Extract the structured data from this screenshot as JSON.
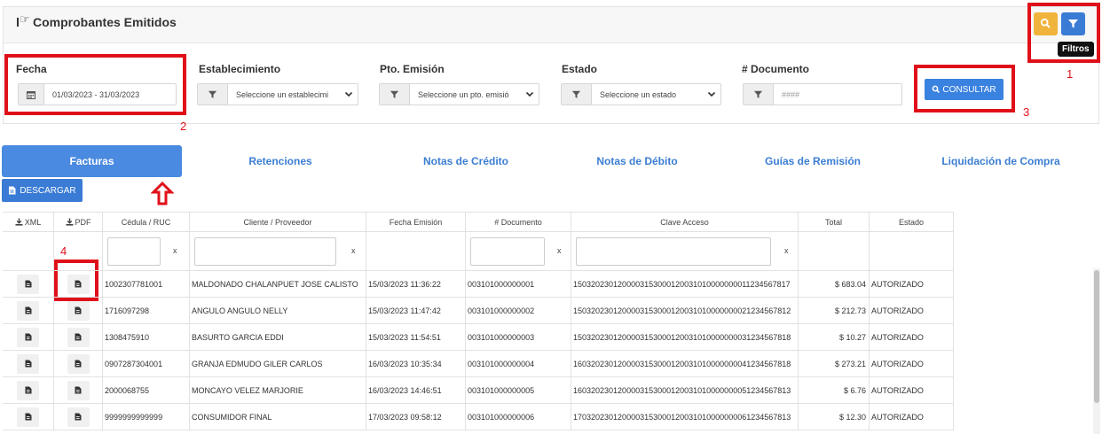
{
  "header": {
    "title": "Comprobantes Emitidos",
    "tooltip": "Filtros",
    "search_icon": "search-icon",
    "filter_icon": "filter-icon"
  },
  "filters": {
    "fecha_label": "Fecha",
    "fecha_value": "01/03/2023 - 31/03/2023",
    "establecimiento_label": "Establecimiento",
    "establecimiento_value": "Seleccione un establecimi",
    "pto_emision_label": "Pto. Emisión",
    "pto_emision_value": "Seleccione un pto. emisió",
    "estado_label": "Estado",
    "estado_value": "Seleccione un estado",
    "documento_label": "# Documento",
    "documento_placeholder": "####",
    "consultar_label": "CONSULTAR"
  },
  "annotations": [
    "1",
    "2",
    "3",
    "4"
  ],
  "tabs": [
    {
      "label": "Facturas",
      "active": true
    },
    {
      "label": "Retenciones"
    },
    {
      "label": "Notas de Crédito"
    },
    {
      "label": "Notas de Débito"
    },
    {
      "label": "Guías de Remisión"
    },
    {
      "label": "Liquidación de Compra"
    }
  ],
  "descargar_label": "DESCARGAR",
  "table": {
    "columns": [
      "XML",
      "PDF",
      "Cédula / RUC",
      "Cliente / Proveedor",
      "Fecha Emisión",
      "# Documento",
      "Clave Acceso",
      "Total",
      "Estado"
    ],
    "filter_clear": "x",
    "rows": [
      {
        "ruc": "1002307781001",
        "cliente": "MALDONADO CHALANPUET JOSE CALISTO",
        "fecha": "15/03/2023 11:36:22",
        "documento": "003101000000001",
        "clave": "1503202301200003153000120031010000000011234567817",
        "total": "$ 683.04",
        "estado": "AUTORIZADO"
      },
      {
        "ruc": "1716097298",
        "cliente": "ANGULO ANGULO NELLY",
        "fecha": "15/03/2023 11:47:42",
        "documento": "003101000000002",
        "clave": "1503202301200003153000120031010000000021234567812",
        "total": "$ 212.73",
        "estado": "AUTORIZADO"
      },
      {
        "ruc": "1308475910",
        "cliente": "BASURTO GARCIA EDDI",
        "fecha": "15/03/2023 11:54:51",
        "documento": "003101000000003",
        "clave": "1503202301200003153000120031010000000031234567818",
        "total": "$ 10.27",
        "estado": "AUTORIZADO"
      },
      {
        "ruc": "0907287304001",
        "cliente": "GRANJA EDMUDO GILER CARLOS",
        "fecha": "16/03/2023 10:35:34",
        "documento": "003101000000004",
        "clave": "1603202301200003153000120031010000000041234567818",
        "total": "$ 273.21",
        "estado": "AUTORIZADO"
      },
      {
        "ruc": "2000068755",
        "cliente": "MONCAYO VELEZ MARJORIE",
        "fecha": "16/03/2023 14:46:51",
        "documento": "003101000000005",
        "clave": "1603202301200003153000120031010000000051234567813",
        "total": "$ 6.76",
        "estado": "AUTORIZADO"
      },
      {
        "ruc": "9999999999999",
        "cliente": "CONSUMIDOR FINAL",
        "fecha": "17/03/2023 09:58:12",
        "documento": "003101000000006",
        "clave": "1703202301200003153000120031010000000061234567813",
        "total": "$ 12.30",
        "estado": "AUTORIZADO"
      }
    ]
  }
}
